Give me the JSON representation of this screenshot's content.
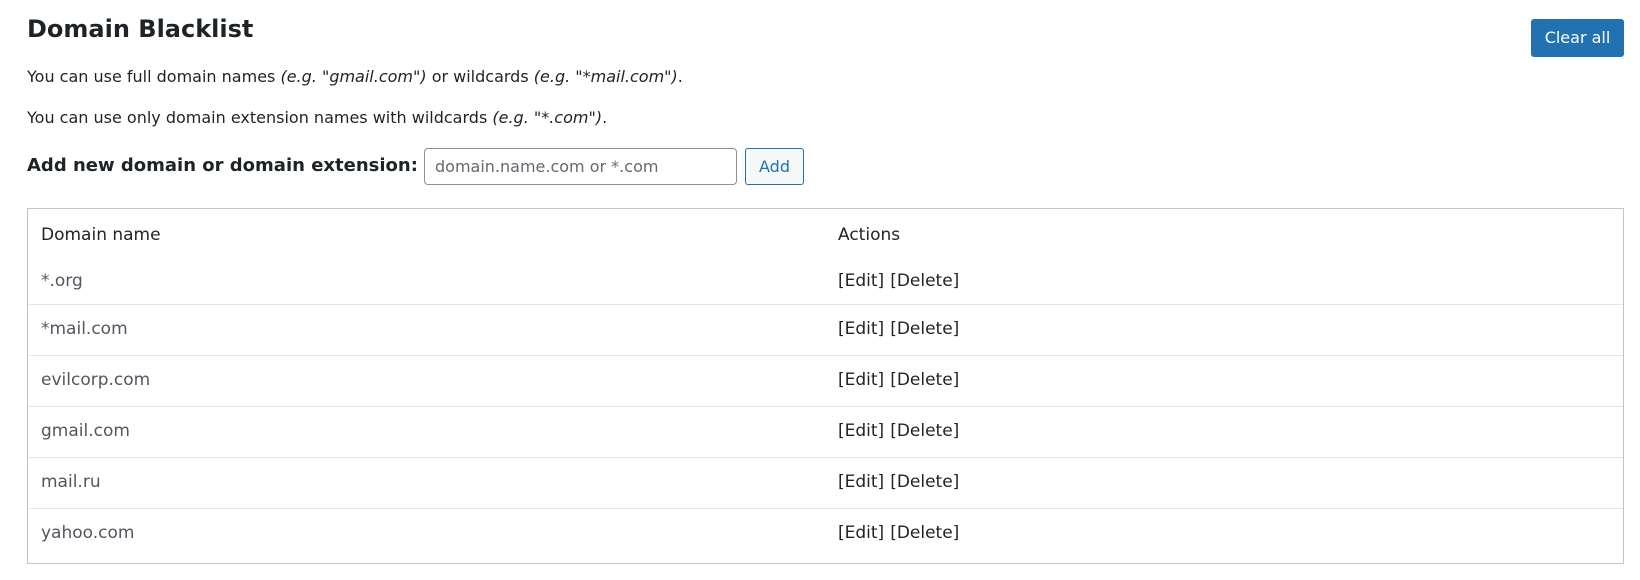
{
  "page": {
    "title": "Domain Blacklist",
    "clear_all_label": "Clear all",
    "description_1": {
      "prefix": "You can use full domain names ",
      "example_1": "(e.g. \"gmail.com\")",
      "middle": " or wildcards ",
      "example_2": "(e.g. \"*mail.com\")",
      "suffix": "."
    },
    "description_2": {
      "prefix": "You can use only domain extension names with wildcards ",
      "example": "(e.g. \"*.com\")",
      "suffix": "."
    }
  },
  "add_form": {
    "label": "Add new domain or domain extension:",
    "input_value": "",
    "input_placeholder": "domain.name.com or *.com",
    "add_label": "Add"
  },
  "table": {
    "headers": {
      "domain": "Domain name",
      "actions": "Actions"
    },
    "rows": [
      {
        "domain": "*.org",
        "edit": "[Edit]",
        "delete": "[Delete]"
      },
      {
        "domain": "*mail.com",
        "edit": "[Edit]",
        "delete": "[Delete]"
      },
      {
        "domain": "evilcorp.com",
        "edit": "[Edit]",
        "delete": "[Delete]"
      },
      {
        "domain": "gmail.com",
        "edit": "[Edit]",
        "delete": "[Delete]"
      },
      {
        "domain": "mail.ru",
        "edit": "[Edit]",
        "delete": "[Delete]"
      },
      {
        "domain": "yahoo.com",
        "edit": "[Edit]",
        "delete": "[Delete]"
      }
    ]
  },
  "colors": {
    "primary": "#2271b1",
    "text": "#1d2327",
    "muted_text": "#50575e",
    "border": "#c3c4c7"
  }
}
